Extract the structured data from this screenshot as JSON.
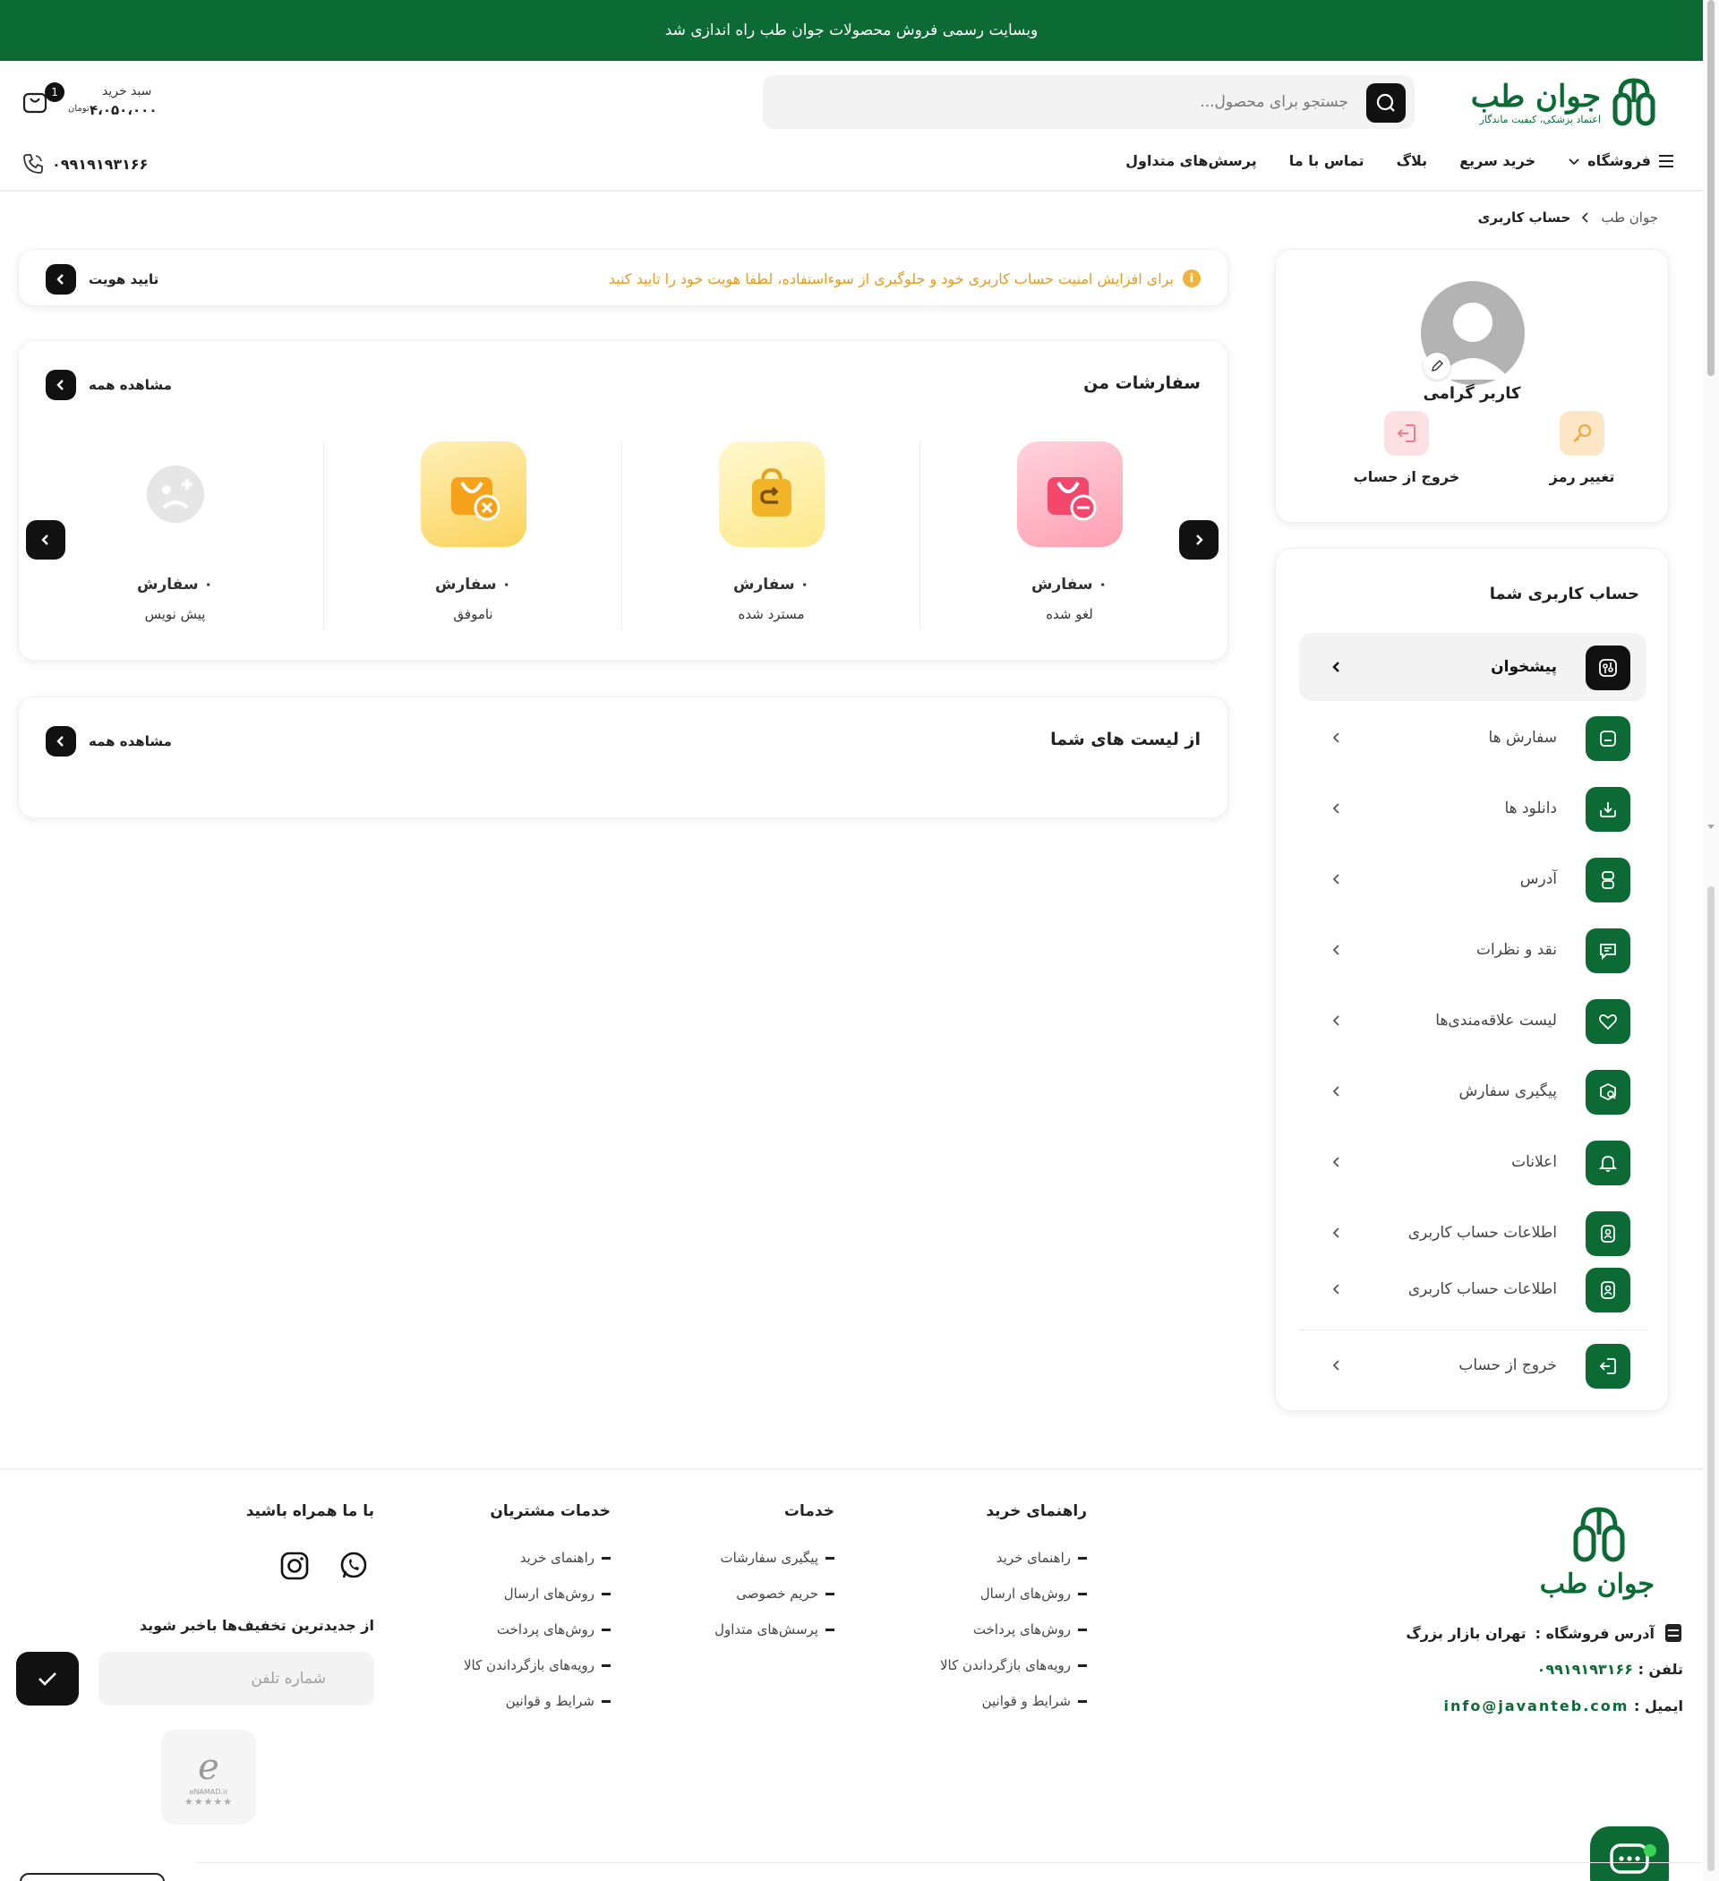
{
  "topbar": {
    "text": "وبسایت رسمی فروش محصولات جوان طب راه اندازی شد"
  },
  "brand": {
    "name": "جوان طب",
    "slogan": "اعتماد پزشکی، کیفیت ماندگار",
    "color": "#0c6b35"
  },
  "search": {
    "placeholder": "جستجو برای محصول..."
  },
  "cart": {
    "label": "سبد خرید",
    "total": "۴،۰۵۰،۰۰۰",
    "currency": "تومان",
    "count": "1"
  },
  "header_phone": "۰۹۹۱۹۱۹۳۱۶۶",
  "nav": {
    "shop": "فروشگاه",
    "quick_buy": "خرید سریع",
    "blog": "بلاگ",
    "contact": "تماس با ما",
    "faq": "پرسش‌های متداول"
  },
  "breadcrumb": {
    "home": "جوان طب",
    "current": "حساب کاربری"
  },
  "profile": {
    "name": "کاربر گرامی",
    "change_password": "تغییر رمز",
    "logout": "خروج از حساب"
  },
  "account_menu": {
    "title": "حساب کاربری شما",
    "items": [
      {
        "label": "پیشخوان",
        "icon": "dashboard-icon"
      },
      {
        "label": "سفارش ها",
        "icon": "orders-icon"
      },
      {
        "label": "دانلود ها",
        "icon": "download-icon"
      },
      {
        "label": "آدرس",
        "icon": "address-icon"
      },
      {
        "label": "نقد و نظرات",
        "icon": "comments-icon"
      },
      {
        "label": "لیست علاقه‌مندی‌ها",
        "icon": "heart-icon"
      },
      {
        "label": "پیگیری سفارش",
        "icon": "tracking-icon"
      },
      {
        "label": "اعلانات",
        "icon": "bell-icon"
      },
      {
        "label": "اطلاعات حساب کاربری",
        "icon": "user-card-icon"
      },
      {
        "label": "اطلاعات حساب کاربری",
        "icon": "user-card-icon"
      },
      {
        "label": "خروج از حساب",
        "icon": "logout-icon"
      }
    ]
  },
  "verify": {
    "message": "برای افزایش امنیت حساب کاربری خود و جلوگیری از سوءاستفاده، لطفا هویت خود را تایید کنید",
    "button": "تایید هویت"
  },
  "orders": {
    "title": "سفارشات من",
    "see_all": "مشاهده همه",
    "tiles": [
      {
        "count": "۰ سفارش",
        "label": "لغو شده",
        "icon": "cancelled-bag-icon"
      },
      {
        "count": "۰ سفارش",
        "label": "مسترد شده",
        "icon": "returned-bag-icon"
      },
      {
        "count": "۰ سفارش",
        "label": "ناموفق",
        "icon": "failed-bag-icon"
      },
      {
        "count": "۰ سفارش",
        "label": "پیش نویس",
        "icon": "draft-face-icon"
      }
    ]
  },
  "lists": {
    "title": "از لیست های شما",
    "see_all": "مشاهده همه"
  },
  "footer": {
    "address_label": "آدرس فروشگاه :",
    "address_value": "تهران بازار بزرگ",
    "phone_label": "تلفن :",
    "phone_value": "۰۹۹۱۹۱۹۳۱۶۶",
    "email_label": "ایمیل :",
    "email_value": "info@javanteb.com",
    "columns": [
      {
        "title": "راهنمای خرید",
        "links": [
          "راهنمای خرید",
          "روش‌های ارسال",
          "روش‌های پرداخت",
          "رویه‌های بازگرداندن کالا",
          "شرایط و قوانین"
        ]
      },
      {
        "title": "خدمات",
        "links": [
          "پیگیری سفارشات",
          "حریم خصوصی",
          "پرسش‌های متداول"
        ]
      },
      {
        "title": "خدمات مشتریان",
        "links": [
          "راهنمای خرید",
          "روش‌های ارسال",
          "روش‌های پرداخت",
          "رویه‌های بازگرداندن کالا",
          "شرایط و قوانین"
        ]
      }
    ],
    "social_title": "با ما همراه باشید",
    "newsletter_title": "از جدیدترین تخفیف‌ها باخبر شوید",
    "newsletter_placeholder": "شماره تلفن",
    "enamad_text": "eNAMAD.ir"
  }
}
